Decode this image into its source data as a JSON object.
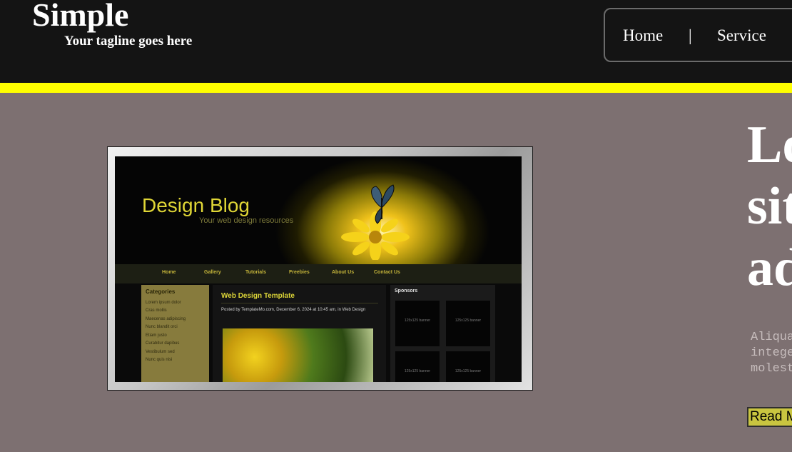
{
  "header": {
    "title": "Simple",
    "tagline": "Your tagline goes here",
    "accent_color": "#ffff00",
    "background_color": "#141414"
  },
  "nav": {
    "items": [
      {
        "label": "Home"
      },
      {
        "label": "Service"
      }
    ],
    "separator": "|"
  },
  "hero_image": {
    "blog_title": "Design Blog",
    "blog_subtitle": "Your web design resources",
    "nav_items": [
      "Home",
      "Gallery",
      "Tutorials",
      "Freebies",
      "About Us",
      "Contact Us"
    ],
    "categories_title": "Categories",
    "categories": [
      "Lorem ipsum dolor",
      "Cras mollis",
      "Maecenas adipiscing",
      "Nunc blandit orci",
      "Etiam justo",
      "Curabitur dapibus",
      "Vestibulum sed",
      "Nunc quis nisi"
    ],
    "post_title": "Web Design Template",
    "post_meta": "Posted by TemplateMo.com, December 6, 2024 at 10:45 am, in Web Design",
    "sponsors_title": "Sponsors",
    "sponsor_banner_label": "125x125 banner"
  },
  "main": {
    "headline_lines": [
      "Lo",
      "sit",
      "ad"
    ],
    "body_lines": [
      "Aliqua",
      "intege",
      "molest"
    ],
    "read_more_label": "Read M",
    "background_color": "#7d7071"
  }
}
